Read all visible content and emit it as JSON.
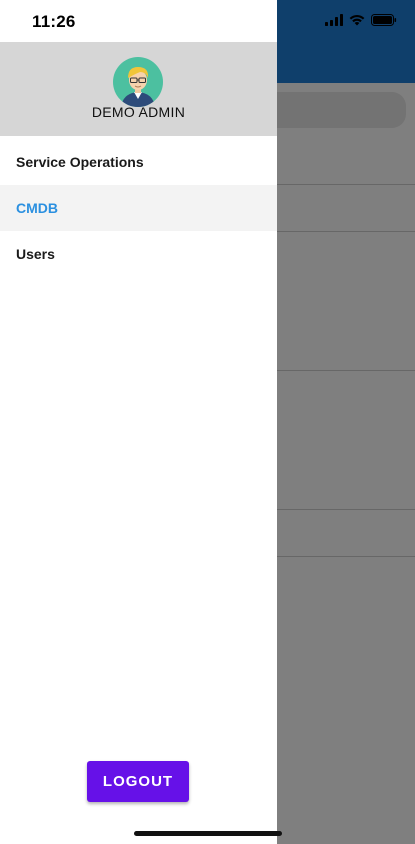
{
  "status_bar": {
    "time": "11:26",
    "icons": [
      "signal-icon",
      "wifi-icon",
      "battery-icon"
    ]
  },
  "colors": {
    "accent": "#6611e8",
    "active_item": "#2b90e0",
    "header_bg": "#1f7fd6"
  },
  "drawer": {
    "user": {
      "name": "DEMO ADMIN",
      "avatar_icon": "user-avatar-icon"
    },
    "menu": {
      "items": [
        {
          "label": "Service Operations",
          "active": false
        },
        {
          "label": "CMDB",
          "active": true
        },
        {
          "label": "Users",
          "active": false
        }
      ]
    },
    "logout_label": "LOGOUT"
  }
}
